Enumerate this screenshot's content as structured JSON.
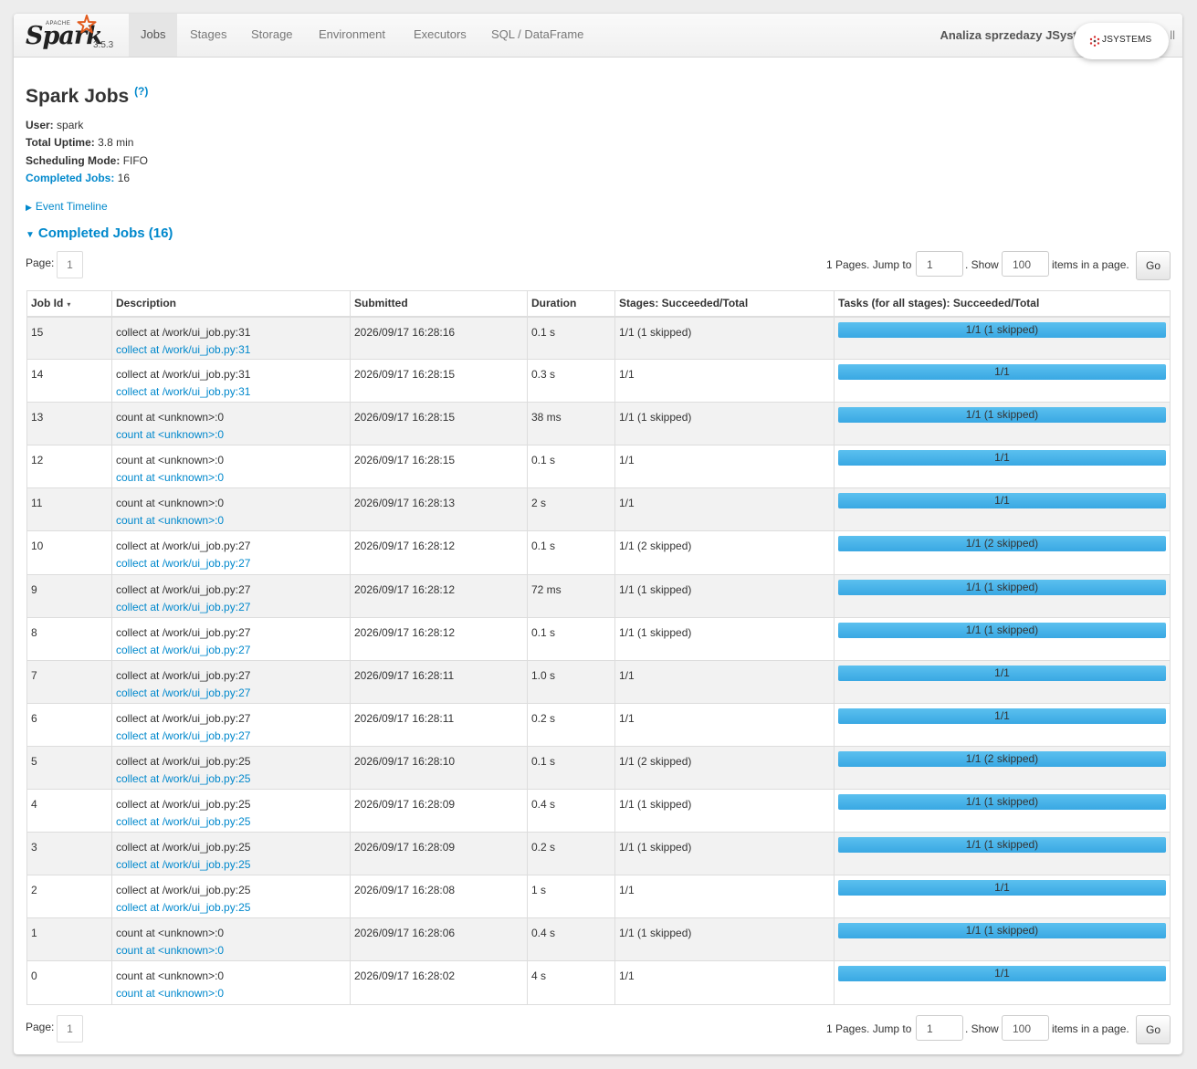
{
  "navbar": {
    "brand_apache": "APACHE",
    "brand_word": "Spark",
    "version": "3.5.3",
    "tabs": [
      {
        "label": "Jobs",
        "active": true
      },
      {
        "label": "Stages",
        "active": false
      },
      {
        "label": "Storage",
        "active": false
      },
      {
        "label": "Environment",
        "active": false
      },
      {
        "label": "Executors",
        "active": false
      },
      {
        "label": "SQL / DataFrame",
        "active": false
      }
    ],
    "app_title": "Analiza sprzedazy JSyste",
    "app_title_tail": "ll",
    "badge_text": "JSYSTEMS"
  },
  "page": {
    "title": "Spark Jobs",
    "help": "(?)",
    "user_label": "User:",
    "user_value": "spark",
    "uptime_label": "Total Uptime:",
    "uptime_value": "3.8 min",
    "sched_label": "Scheduling Mode:",
    "sched_value": "FIFO",
    "completed_label": "Completed Jobs:",
    "completed_value": "16",
    "event_timeline": "Event Timeline",
    "section_title": "Completed Jobs (16)"
  },
  "pagination": {
    "page_label": "Page:",
    "page_number": "1",
    "pages_text": "1 Pages. Jump to",
    "jump_value": "1",
    "show_text": ". Show",
    "show_value": "100",
    "items_text": "items in a page.",
    "go_label": "Go"
  },
  "table": {
    "headers": [
      "Job Id",
      "Description",
      "Submitted",
      "Duration",
      "Stages: Succeeded/Total",
      "Tasks (for all stages): Succeeded/Total"
    ],
    "sort_indicator": "▾",
    "rows": [
      {
        "id": "15",
        "desc": "collect at /work/ui_job.py:31",
        "link": "collect at /work/ui_job.py:31",
        "submitted": "2026/09/17 16:28:16",
        "duration": "0.1 s",
        "stages": "1/1 (1 skipped)",
        "tasks": "1/1 (1 skipped)",
        "progress": 1.0
      },
      {
        "id": "14",
        "desc": "collect at /work/ui_job.py:31",
        "link": "collect at /work/ui_job.py:31",
        "submitted": "2026/09/17 16:28:15",
        "duration": "0.3 s",
        "stages": "1/1",
        "tasks": "1/1",
        "progress": 1.0
      },
      {
        "id": "13",
        "desc": "count at <unknown>:0",
        "link": "count at <unknown>:0",
        "submitted": "2026/09/17 16:28:15",
        "duration": "38 ms",
        "stages": "1/1 (1 skipped)",
        "tasks": "1/1 (1 skipped)",
        "progress": 1.0
      },
      {
        "id": "12",
        "desc": "count at <unknown>:0",
        "link": "count at <unknown>:0",
        "submitted": "2026/09/17 16:28:15",
        "duration": "0.1 s",
        "stages": "1/1",
        "tasks": "1/1",
        "progress": 1.0
      },
      {
        "id": "11",
        "desc": "count at <unknown>:0",
        "link": "count at <unknown>:0",
        "submitted": "2026/09/17 16:28:13",
        "duration": "2 s",
        "stages": "1/1",
        "tasks": "1/1",
        "progress": 1.0
      },
      {
        "id": "10",
        "desc": "collect at /work/ui_job.py:27",
        "link": "collect at /work/ui_job.py:27",
        "submitted": "2026/09/17 16:28:12",
        "duration": "0.1 s",
        "stages": "1/1 (2 skipped)",
        "tasks": "1/1 (2 skipped)",
        "progress": 1.0
      },
      {
        "id": "9",
        "desc": "collect at /work/ui_job.py:27",
        "link": "collect at /work/ui_job.py:27",
        "submitted": "2026/09/17 16:28:12",
        "duration": "72 ms",
        "stages": "1/1 (1 skipped)",
        "tasks": "1/1 (1 skipped)",
        "progress": 1.0
      },
      {
        "id": "8",
        "desc": "collect at /work/ui_job.py:27",
        "link": "collect at /work/ui_job.py:27",
        "submitted": "2026/09/17 16:28:12",
        "duration": "0.1 s",
        "stages": "1/1 (1 skipped)",
        "tasks": "1/1 (1 skipped)",
        "progress": 1.0
      },
      {
        "id": "7",
        "desc": "collect at /work/ui_job.py:27",
        "link": "collect at /work/ui_job.py:27",
        "submitted": "2026/09/17 16:28:11",
        "duration": "1.0 s",
        "stages": "1/1",
        "tasks": "1/1",
        "progress": 1.0
      },
      {
        "id": "6",
        "desc": "collect at /work/ui_job.py:27",
        "link": "collect at /work/ui_job.py:27",
        "submitted": "2026/09/17 16:28:11",
        "duration": "0.2 s",
        "stages": "1/1",
        "tasks": "1/1",
        "progress": 1.0
      },
      {
        "id": "5",
        "desc": "collect at /work/ui_job.py:25",
        "link": "collect at /work/ui_job.py:25",
        "submitted": "2026/09/17 16:28:10",
        "duration": "0.1 s",
        "stages": "1/1 (2 skipped)",
        "tasks": "1/1 (2 skipped)",
        "progress": 1.0
      },
      {
        "id": "4",
        "desc": "collect at /work/ui_job.py:25",
        "link": "collect at /work/ui_job.py:25",
        "submitted": "2026/09/17 16:28:09",
        "duration": "0.4 s",
        "stages": "1/1 (1 skipped)",
        "tasks": "1/1 (1 skipped)",
        "progress": 1.0
      },
      {
        "id": "3",
        "desc": "collect at /work/ui_job.py:25",
        "link": "collect at /work/ui_job.py:25",
        "submitted": "2026/09/17 16:28:09",
        "duration": "0.2 s",
        "stages": "1/1 (1 skipped)",
        "tasks": "1/1 (1 skipped)",
        "progress": 1.0
      },
      {
        "id": "2",
        "desc": "collect at /work/ui_job.py:25",
        "link": "collect at /work/ui_job.py:25",
        "submitted": "2026/09/17 16:28:08",
        "duration": "1 s",
        "stages": "1/1",
        "tasks": "1/1",
        "progress": 1.0
      },
      {
        "id": "1",
        "desc": "count at <unknown>:0",
        "link": "count at <unknown>:0",
        "submitted": "2026/09/17 16:28:06",
        "duration": "0.4 s",
        "stages": "1/1 (1 skipped)",
        "tasks": "1/1 (1 skipped)",
        "progress": 1.0
      },
      {
        "id": "0",
        "desc": "count at <unknown>:0",
        "link": "count at <unknown>:0",
        "submitted": "2026/09/17 16:28:02",
        "duration": "4 s",
        "stages": "1/1",
        "tasks": "1/1",
        "progress": 1.0
      }
    ]
  },
  "colors": {
    "link": "#0088cc",
    "progress_bar": "#3fabe5",
    "brand_star": "#e25a1c"
  }
}
